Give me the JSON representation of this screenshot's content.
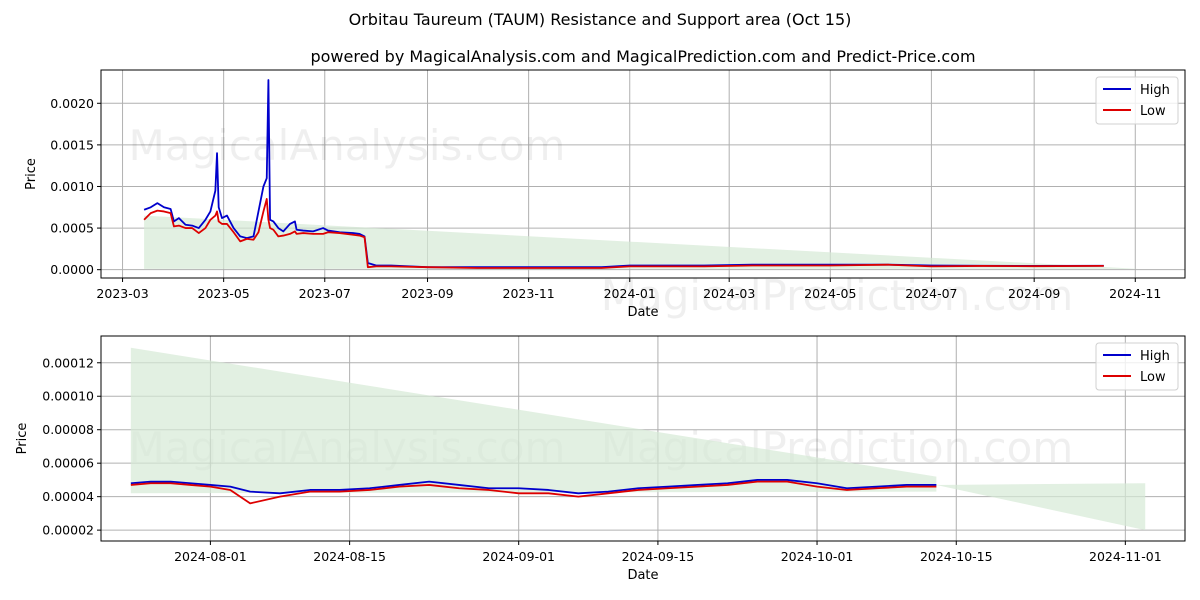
{
  "title": "Orbitau Taureum (TAUM) Resistance and Support area (Oct 15)",
  "subtitle": "powered by MagicalAnalysis.com and MagicalPrediction.com and Predict-Price.com",
  "watermarks": [
    "MagicalAnalysis.com",
    "MagicalPrediction.com"
  ],
  "colors": {
    "high": "#0000cc",
    "low": "#dd0000",
    "band": "#d6ead6"
  },
  "chart_data": [
    {
      "type": "line",
      "name": "full-history",
      "xlabel": "Date",
      "ylabel": "Price",
      "grid": true,
      "legend": {
        "placement": "top-right",
        "entries": [
          "High",
          "Low"
        ]
      },
      "xlim": [
        "2023-02-16",
        "2024-12-01"
      ],
      "ylim": [
        -0.0001,
        0.0024
      ],
      "xticks": [
        "2023-03-01",
        "2023-05-01",
        "2023-07-01",
        "2023-09-01",
        "2023-11-01",
        "2024-01-01",
        "2024-03-01",
        "2024-05-01",
        "2024-07-01",
        "2024-09-01",
        "2024-11-01"
      ],
      "xtick_labels": [
        "2023-03",
        "2023-05",
        "2023-07",
        "2023-09",
        "2023-11",
        "2024-01",
        "2024-03",
        "2024-05",
        "2024-07",
        "2024-09",
        "2024-11"
      ],
      "yticks": [
        0.0,
        0.0005,
        0.001,
        0.0015,
        0.002
      ],
      "ytick_labels": [
        "0.0000",
        "0.0005",
        "0.0010",
        "0.0015",
        "0.0020"
      ],
      "band": {
        "x": [
          "2023-03-14",
          "2024-11-03"
        ],
        "upper": [
          0.00065,
          1e-05
        ],
        "lower": [
          1e-05,
          1e-05
        ]
      },
      "series": [
        {
          "name": "High",
          "x": [
            "2023-03-14",
            "2023-03-18",
            "2023-03-22",
            "2023-03-26",
            "2023-03-30",
            "2023-04-01",
            "2023-04-04",
            "2023-04-08",
            "2023-04-12",
            "2023-04-16",
            "2023-04-20",
            "2023-04-23",
            "2023-04-26",
            "2023-04-27",
            "2023-04-28",
            "2023-04-30",
            "2023-05-03",
            "2023-05-07",
            "2023-05-11",
            "2023-05-15",
            "2023-05-19",
            "2023-05-22",
            "2023-05-25",
            "2023-05-27",
            "2023-05-28",
            "2023-05-29",
            "2023-05-31",
            "2023-06-03",
            "2023-06-06",
            "2023-06-10",
            "2023-06-13",
            "2023-06-14",
            "2023-06-18",
            "2023-06-24",
            "2023-06-30",
            "2023-07-03",
            "2023-07-10",
            "2023-07-18",
            "2023-07-22",
            "2023-07-25",
            "2023-07-27",
            "2023-08-01",
            "2023-08-10",
            "2023-09-01",
            "2023-10-01",
            "2023-11-01",
            "2023-12-15",
            "2024-01-01",
            "2024-02-15",
            "2024-03-15",
            "2024-05-01",
            "2024-06-05",
            "2024-07-01",
            "2024-08-01",
            "2024-09-01",
            "2024-10-13"
          ],
          "values": [
            0.00072,
            0.00075,
            0.0008,
            0.00075,
            0.00073,
            0.00058,
            0.00062,
            0.00054,
            0.00053,
            0.0005,
            0.0006,
            0.0007,
            0.00095,
            0.0014,
            0.00075,
            0.00062,
            0.00065,
            0.0005,
            0.0004,
            0.00038,
            0.0004,
            0.0007,
            0.001,
            0.0011,
            0.00228,
            0.0006,
            0.00058,
            0.0005,
            0.00046,
            0.00055,
            0.00058,
            0.00048,
            0.00047,
            0.00046,
            0.0005,
            0.00047,
            0.00045,
            0.00044,
            0.00043,
            0.0004,
            8e-05,
            5e-05,
            5e-05,
            3e-05,
            3e-05,
            3e-05,
            3e-05,
            5e-05,
            5e-05,
            6e-05,
            6e-05,
            6e-05,
            5e-05,
            4.7e-05,
            4.5e-05,
            4.7e-05
          ]
        },
        {
          "name": "Low",
          "x": [
            "2023-03-14",
            "2023-03-18",
            "2023-03-22",
            "2023-03-26",
            "2023-03-30",
            "2023-04-01",
            "2023-04-04",
            "2023-04-08",
            "2023-04-12",
            "2023-04-16",
            "2023-04-20",
            "2023-04-23",
            "2023-04-26",
            "2023-04-27",
            "2023-04-28",
            "2023-04-30",
            "2023-05-03",
            "2023-05-07",
            "2023-05-11",
            "2023-05-15",
            "2023-05-19",
            "2023-05-22",
            "2023-05-25",
            "2023-05-27",
            "2023-05-28",
            "2023-05-29",
            "2023-05-31",
            "2023-06-03",
            "2023-06-06",
            "2023-06-10",
            "2023-06-13",
            "2023-06-14",
            "2023-06-18",
            "2023-06-24",
            "2023-06-30",
            "2023-07-03",
            "2023-07-10",
            "2023-07-18",
            "2023-07-22",
            "2023-07-25",
            "2023-07-27",
            "2023-08-01",
            "2023-08-10",
            "2023-09-01",
            "2023-10-01",
            "2023-11-01",
            "2023-12-15",
            "2024-01-01",
            "2024-02-15",
            "2024-03-15",
            "2024-05-01",
            "2024-06-05",
            "2024-07-01",
            "2024-08-01",
            "2024-09-01",
            "2024-10-13"
          ],
          "values": [
            0.0006,
            0.00068,
            0.00071,
            0.0007,
            0.00068,
            0.00052,
            0.00053,
            0.0005,
            0.0005,
            0.00044,
            0.0005,
            0.0006,
            0.00065,
            0.0007,
            0.00058,
            0.00055,
            0.00055,
            0.00045,
            0.00034,
            0.00037,
            0.00036,
            0.00045,
            0.0007,
            0.00085,
            0.0006,
            0.0005,
            0.00048,
            0.0004,
            0.00041,
            0.00043,
            0.00046,
            0.00043,
            0.00044,
            0.00043,
            0.00043,
            0.00045,
            0.00044,
            0.00042,
            0.00041,
            0.00039,
            3e-05,
            4e-05,
            4e-05,
            3e-05,
            2e-05,
            2e-05,
            2e-05,
            4e-05,
            4e-05,
            5e-05,
            5e-05,
            6e-05,
            4e-05,
            4.5e-05,
            4.2e-05,
            4.6e-05
          ]
        }
      ]
    },
    {
      "type": "line",
      "name": "recent-zoom",
      "xlabel": "Date",
      "ylabel": "Price",
      "grid": true,
      "legend": {
        "placement": "top-right",
        "entries": [
          "High",
          "Low"
        ]
      },
      "xlim": [
        "2024-07-21",
        "2024-11-07"
      ],
      "ylim": [
        1.35e-05,
        0.000136
      ],
      "xticks": [
        "2024-08-01",
        "2024-08-15",
        "2024-09-01",
        "2024-09-15",
        "2024-10-01",
        "2024-10-15",
        "2024-11-01"
      ],
      "xtick_labels": [
        "2024-08-01",
        "2024-08-15",
        "2024-09-01",
        "2024-09-15",
        "2024-10-01",
        "2024-10-15",
        "2024-11-01"
      ],
      "yticks": [
        2e-05,
        4e-05,
        6e-05,
        8e-05,
        0.0001,
        0.00012
      ],
      "ytick_labels": [
        "0.00002",
        "0.00004",
        "0.00006",
        "0.00008",
        "0.00010",
        "0.00012"
      ],
      "band": {
        "x": [
          "2024-07-24",
          "2024-10-13",
          "2024-10-13",
          "2024-11-03"
        ],
        "upper": [
          0.000129,
          5.2e-05,
          4.7e-05,
          4.8e-05
        ],
        "lower": [
          4.2e-05,
          4.3e-05,
          4.7e-05,
          2e-05
        ]
      },
      "series": [
        {
          "name": "High",
          "x": [
            "2024-07-24",
            "2024-07-26",
            "2024-07-28",
            "2024-07-30",
            "2024-08-01",
            "2024-08-03",
            "2024-08-05",
            "2024-08-08",
            "2024-08-11",
            "2024-08-14",
            "2024-08-17",
            "2024-08-20",
            "2024-08-23",
            "2024-08-26",
            "2024-08-29",
            "2024-09-01",
            "2024-09-04",
            "2024-09-07",
            "2024-09-10",
            "2024-09-13",
            "2024-09-16",
            "2024-09-19",
            "2024-09-22",
            "2024-09-25",
            "2024-09-28",
            "2024-10-01",
            "2024-10-04",
            "2024-10-07",
            "2024-10-10",
            "2024-10-13"
          ],
          "values": [
            4.8e-05,
            4.9e-05,
            4.9e-05,
            4.8e-05,
            4.7e-05,
            4.6e-05,
            4.3e-05,
            4.2e-05,
            4.4e-05,
            4.4e-05,
            4.5e-05,
            4.7e-05,
            4.9e-05,
            4.7e-05,
            4.5e-05,
            4.5e-05,
            4.4e-05,
            4.2e-05,
            4.3e-05,
            4.5e-05,
            4.6e-05,
            4.7e-05,
            4.8e-05,
            5e-05,
            5e-05,
            4.8e-05,
            4.5e-05,
            4.6e-05,
            4.7e-05,
            4.7e-05
          ]
        },
        {
          "name": "Low",
          "x": [
            "2024-07-24",
            "2024-07-26",
            "2024-07-28",
            "2024-07-30",
            "2024-08-01",
            "2024-08-03",
            "2024-08-05",
            "2024-08-08",
            "2024-08-11",
            "2024-08-14",
            "2024-08-17",
            "2024-08-20",
            "2024-08-23",
            "2024-08-26",
            "2024-08-29",
            "2024-09-01",
            "2024-09-04",
            "2024-09-07",
            "2024-09-10",
            "2024-09-13",
            "2024-09-16",
            "2024-09-19",
            "2024-09-22",
            "2024-09-25",
            "2024-09-28",
            "2024-10-01",
            "2024-10-04",
            "2024-10-07",
            "2024-10-10",
            "2024-10-13"
          ],
          "values": [
            4.7e-05,
            4.8e-05,
            4.8e-05,
            4.7e-05,
            4.6e-05,
            4.4e-05,
            3.6e-05,
            4e-05,
            4.3e-05,
            4.3e-05,
            4.4e-05,
            4.6e-05,
            4.7e-05,
            4.5e-05,
            4.4e-05,
            4.2e-05,
            4.2e-05,
            4e-05,
            4.2e-05,
            4.4e-05,
            4.5e-05,
            4.6e-05,
            4.7e-05,
            4.9e-05,
            4.9e-05,
            4.6e-05,
            4.4e-05,
            4.5e-05,
            4.6e-05,
            4.6e-05
          ]
        }
      ]
    }
  ]
}
